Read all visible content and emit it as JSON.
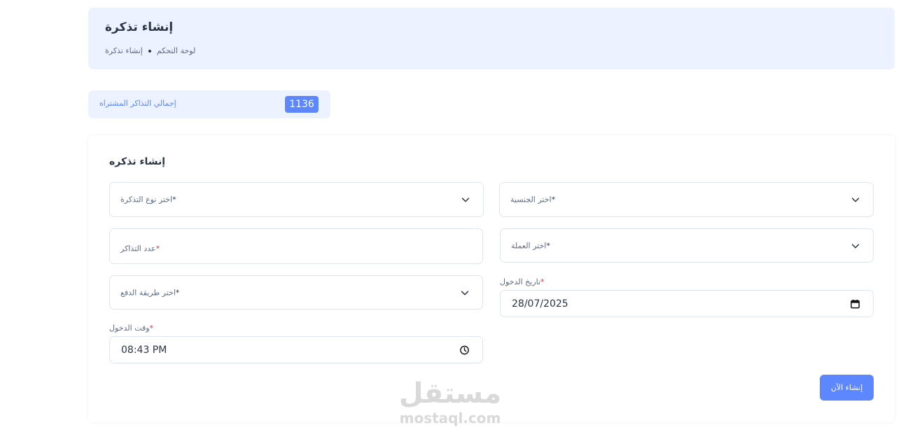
{
  "header": {
    "title": "إنشاء تذكرة",
    "breadcrumb": {
      "current": "إنشاء تذكرة",
      "home": "لوحة التحكم"
    }
  },
  "stats": {
    "label": "إجمالي التذاكر المشتراه",
    "value": "1136"
  },
  "form": {
    "title": "إنشاء تذكره",
    "ticket_type": {
      "placeholder": "اختر نوع التذكرة",
      "required": "*"
    },
    "nationality": {
      "placeholder": "اختر الجنسية",
      "required": "*"
    },
    "ticket_count": {
      "placeholder": "عدد التذاكر",
      "required": "*"
    },
    "currency": {
      "placeholder": "اختر العملة",
      "required": "*"
    },
    "payment_method": {
      "placeholder": "اختر طريقة الدفع",
      "required": "*"
    },
    "entry_date": {
      "label": "تاريخ الدخول",
      "required": "*",
      "value": "28/07/2025"
    },
    "entry_time": {
      "label": "وقت الدخول",
      "required": "*",
      "value": "08:43 PM"
    },
    "submit_label": "إنشاء الآن"
  },
  "watermark": {
    "arabic": "مستقل",
    "latin": "mostaql.com"
  },
  "colors": {
    "primary": "#5d87ff",
    "light_primary": "#ecf2ff",
    "text_dark": "#2a3547",
    "required_red": "#e5333a",
    "border": "#dfe5ef"
  },
  "icons": {
    "select_arrow": "chevron-down-icon",
    "date": "calendar-icon",
    "time": "clock-icon"
  }
}
